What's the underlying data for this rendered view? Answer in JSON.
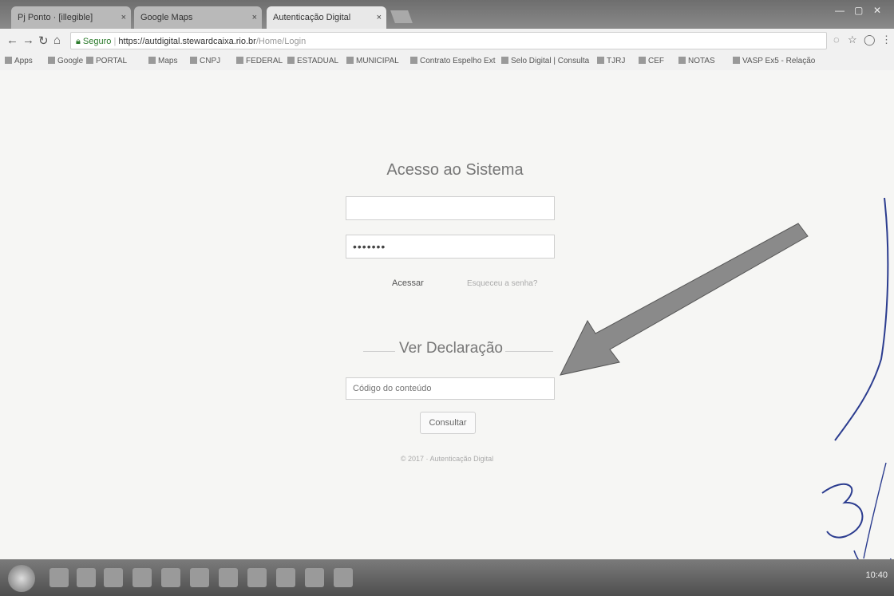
{
  "browser": {
    "tabs": [
      {
        "label": "Pj Ponto · [illegible]"
      },
      {
        "label": "Google Maps"
      },
      {
        "label": "Autenticação Digital"
      }
    ],
    "address": {
      "secure_label": "Seguro",
      "host": "https://autdigital.stewardcaixa.rio.br",
      "path": "/Home/Login"
    },
    "bookmarks": [
      "Apps",
      "Google",
      "PORTAL",
      "Maps",
      "CNPJ",
      "FEDERAL",
      "ESTADUAL",
      "MUNICIPAL",
      "Contrato Espelho Ext",
      "Selo Digital | Consulta",
      "TJRJ",
      "CEF",
      "NOTAS",
      "VASP Ex5 - Relação"
    ]
  },
  "login": {
    "title": "Acesso ao Sistema",
    "user_placeholder": "",
    "password_mask": "•••••••",
    "submit_label": "Acessar",
    "forgot_label": "Esqueceu a senha?"
  },
  "declaration": {
    "title": "Ver Declaração",
    "code_placeholder": "Código do conteúdo",
    "consult_label": "Consultar"
  },
  "footer": {
    "copyright": "© 2017 · Autenticação Digital"
  },
  "taskbar": {
    "clock": "10:40"
  },
  "colors": {
    "page_bg": "#f6f6f4",
    "arrow": "#8a8a8a",
    "ink": "#2b3c8f"
  }
}
